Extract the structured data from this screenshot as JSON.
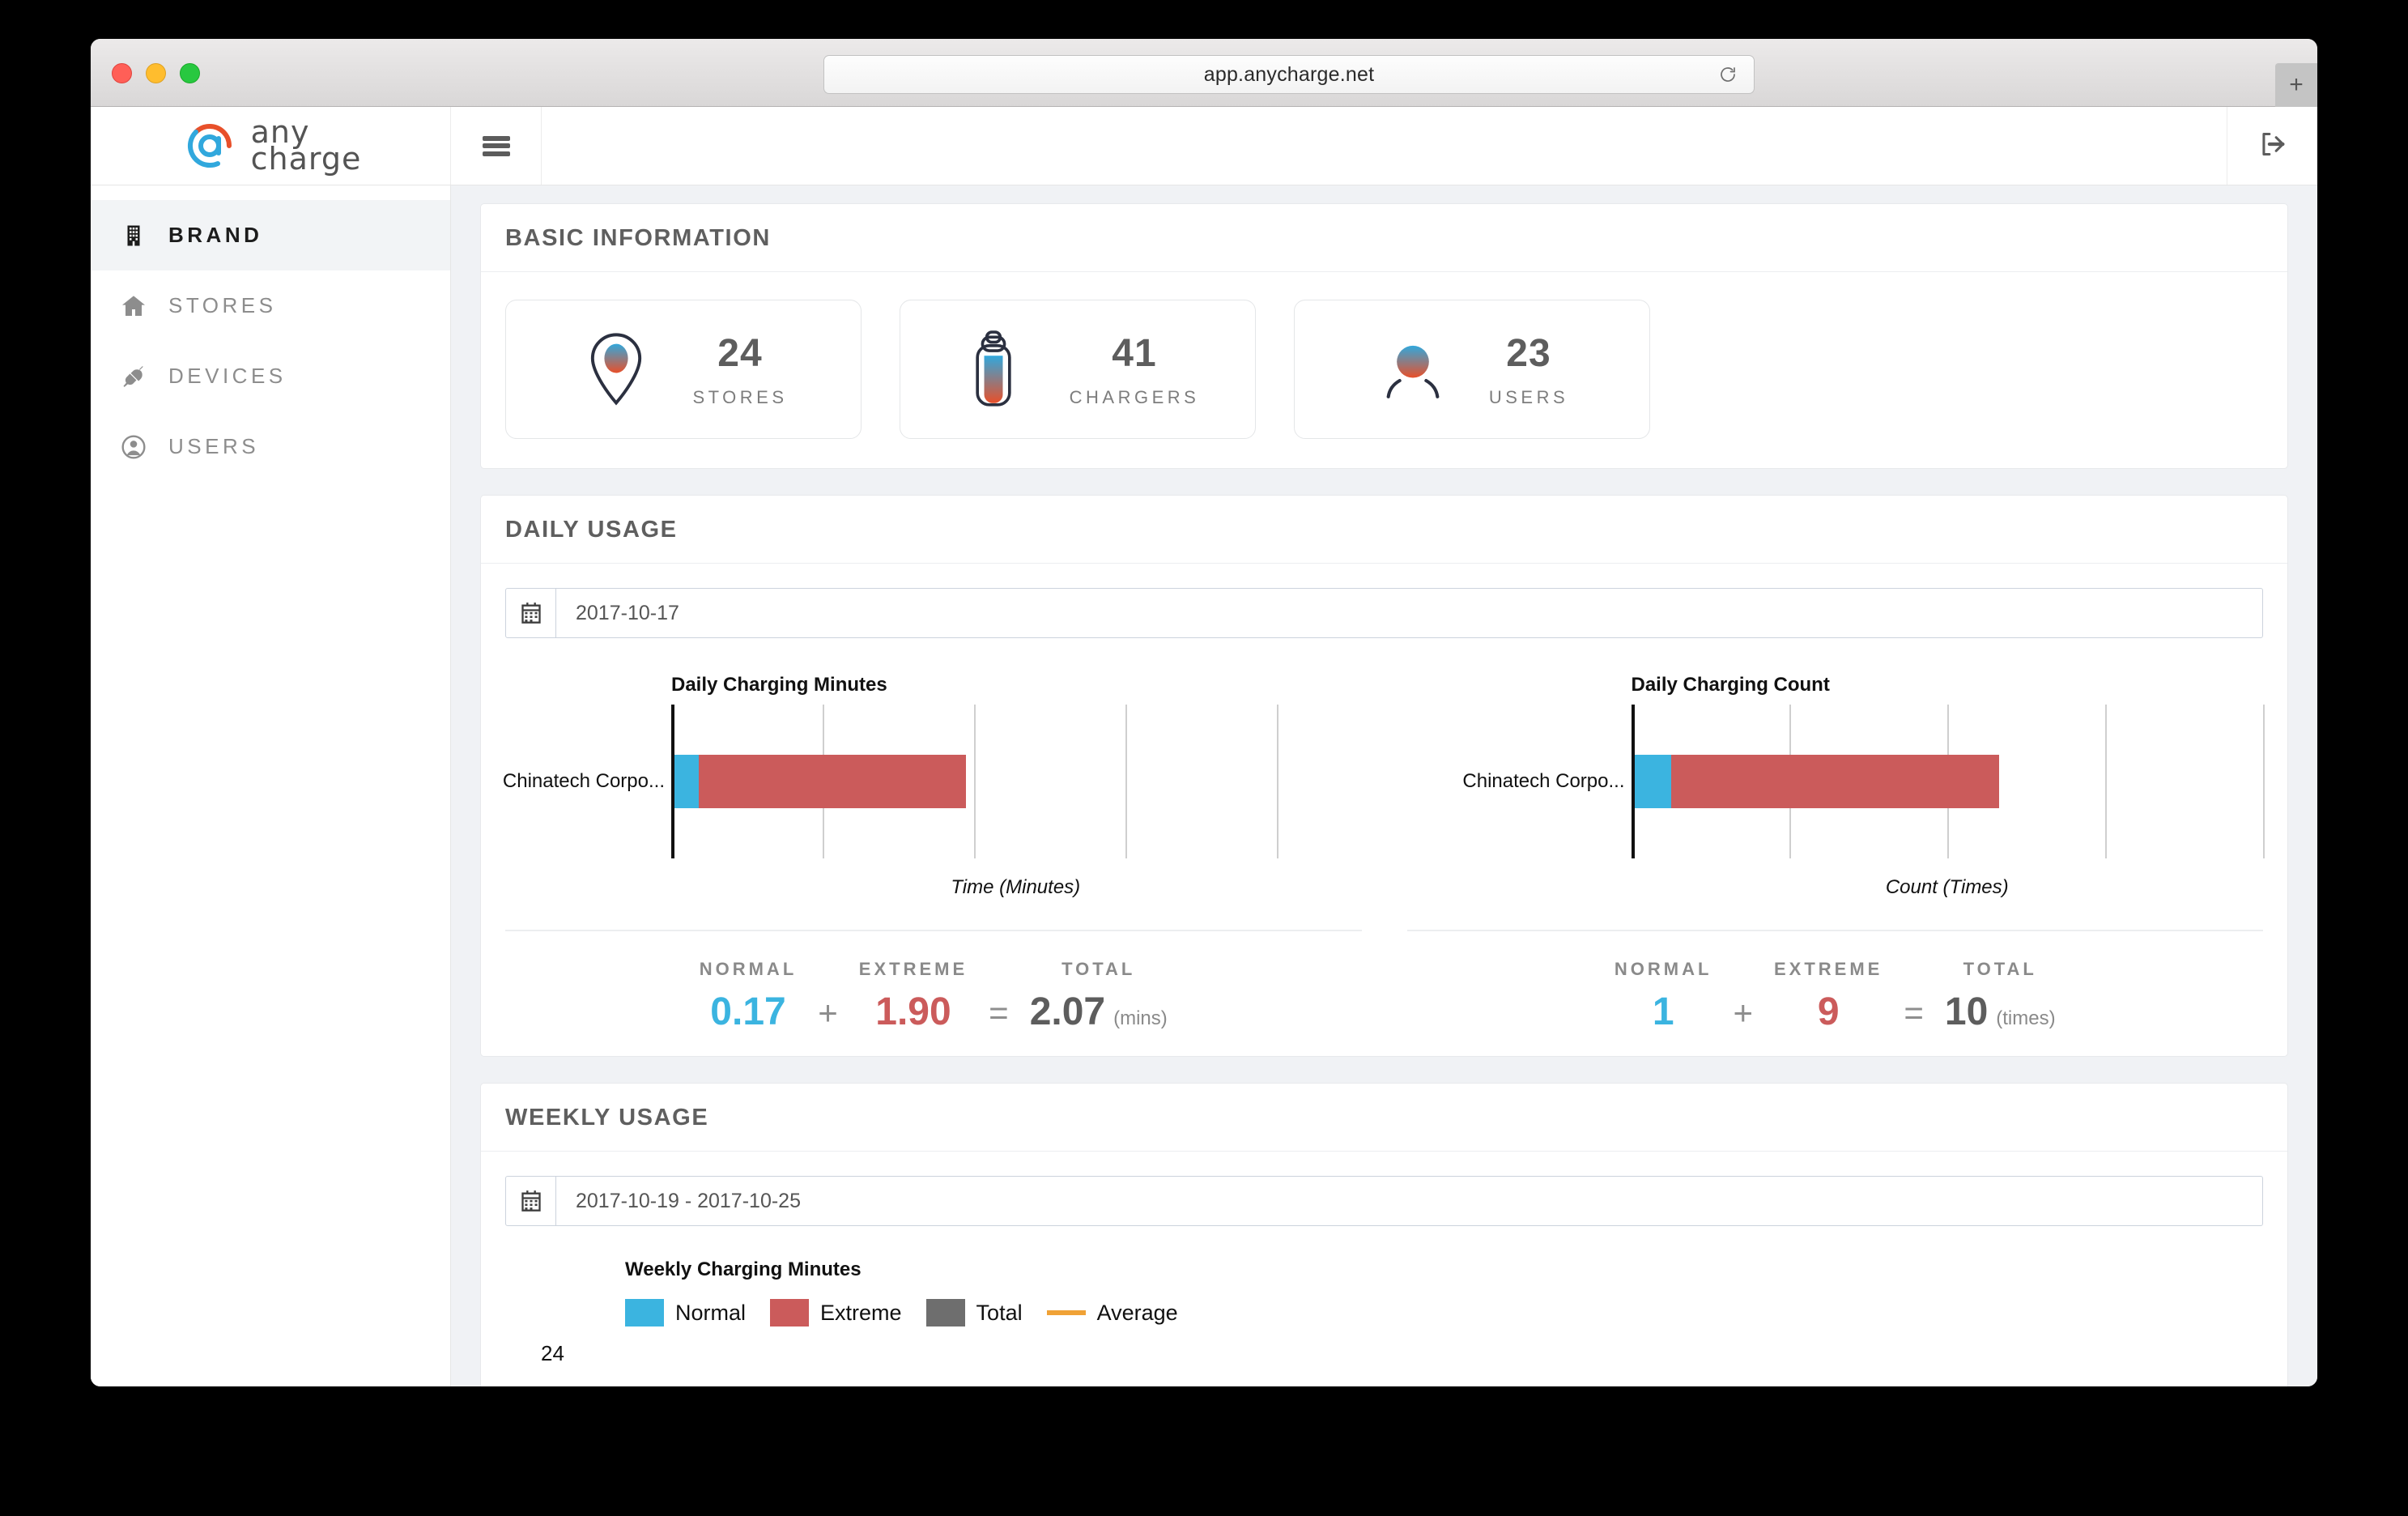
{
  "browser": {
    "url": "app.anycharge.net",
    "reload_icon": "reload-icon",
    "new_tab_label": "+"
  },
  "header": {
    "logo_line1": "any",
    "logo_line2": "charge",
    "menu_icon": "hamburger-menu-icon",
    "logout_icon": "logout-icon"
  },
  "sidebar": {
    "items": [
      {
        "label": "BRAND",
        "icon": "building-icon",
        "active": true
      },
      {
        "label": "STORES",
        "icon": "home-icon",
        "active": false
      },
      {
        "label": "DEVICES",
        "icon": "plug-icon",
        "active": false
      },
      {
        "label": "USERS",
        "icon": "user-circle-icon",
        "active": false
      }
    ]
  },
  "basic_information": {
    "title": "BASIC INFORMATION",
    "cards": [
      {
        "value": "24",
        "label": "STORES",
        "icon": "map-pin-icon"
      },
      {
        "value": "41",
        "label": "CHARGERS",
        "icon": "battery-icon"
      },
      {
        "value": "23",
        "label": "USERS",
        "icon": "user-icon"
      }
    ]
  },
  "daily_usage": {
    "title": "DAILY USAGE",
    "date_value": "2017-10-17",
    "date_icon": "calendar-icon",
    "summary_headers": {
      "normal": "NORMAL",
      "extreme": "EXTREME",
      "total": "TOTAL"
    },
    "operators": {
      "plus": "+",
      "equals": "="
    },
    "minutes_summary": {
      "normal": "0.17",
      "extreme": "1.90",
      "total": "2.07",
      "unit": "(mins)"
    },
    "count_summary": {
      "normal": "1",
      "extreme": "9",
      "total": "10",
      "unit": "(times)"
    }
  },
  "weekly_usage": {
    "title": "WEEKLY USAGE",
    "date_value": "2017-10-19 - 2017-10-25",
    "date_icon": "calendar-icon",
    "chart_title": "Weekly Charging Minutes",
    "legend": [
      {
        "label": "Normal",
        "color": "#3bb4e0",
        "shape": "swatch"
      },
      {
        "label": "Extreme",
        "color": "#cb5b5b",
        "shape": "swatch"
      },
      {
        "label": "Total",
        "color": "#6e6e6e",
        "shape": "swatch"
      },
      {
        "label": "Average",
        "color": "#f0a236",
        "shape": "line"
      }
    ],
    "visible_axis_tick": "24"
  },
  "colors": {
    "normal": "#3bb4e0",
    "extreme": "#cb5b5b",
    "total": "#6e6e6e",
    "average": "#f0a236",
    "brand_orange": "#e8502a",
    "brand_blue": "#31a8dd",
    "content_bg": "#f0f2f5"
  },
  "chart_data": [
    {
      "type": "bar",
      "title": "Daily Charging Minutes",
      "orientation": "horizontal",
      "stacked": true,
      "categories": [
        "Chinatech Corpo..."
      ],
      "series": [
        {
          "name": "Normal",
          "values": [
            0.17
          ],
          "color": "#3bb4e0"
        },
        {
          "name": "Extreme",
          "values": [
            1.9
          ],
          "color": "#cb5b5b"
        }
      ],
      "xlabel": "Time (Minutes)",
      "ylabel": "",
      "xlim": [
        0,
        2.5
      ],
      "grid": true,
      "gridline_count": 4,
      "legend": "none"
    },
    {
      "type": "bar",
      "title": "Daily Charging Count",
      "orientation": "horizontal",
      "stacked": true,
      "categories": [
        "Chinatech Corpo..."
      ],
      "series": [
        {
          "name": "Normal",
          "values": [
            1
          ],
          "color": "#3bb4e0"
        },
        {
          "name": "Extreme",
          "values": [
            9
          ],
          "color": "#cb5b5b"
        }
      ],
      "xlabel": "Count (Times)",
      "ylabel": "",
      "xlim": [
        0,
        10
      ],
      "grid": true,
      "gridline_count": 4,
      "legend": "none"
    },
    {
      "type": "bar",
      "title": "Weekly Charging Minutes",
      "orientation": "vertical",
      "categories": [],
      "series": [
        {
          "name": "Normal",
          "values": [],
          "color": "#3bb4e0"
        },
        {
          "name": "Extreme",
          "values": [],
          "color": "#cb5b5b"
        },
        {
          "name": "Total",
          "values": [],
          "color": "#6e6e6e"
        },
        {
          "name": "Average",
          "values": [],
          "color": "#f0a236",
          "type": "line"
        }
      ],
      "xlabel": "",
      "ylabel": "",
      "visible_y_ticks": [
        "24"
      ],
      "legend": "top",
      "note": "chart clipped by window bottom edge"
    }
  ]
}
